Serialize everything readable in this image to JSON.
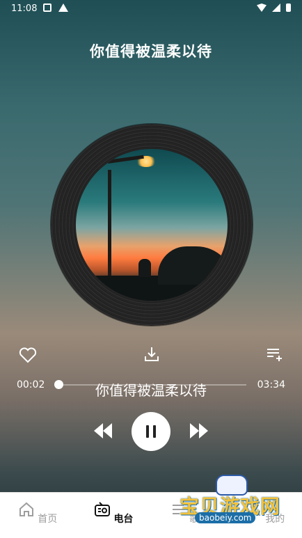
{
  "status_bar": {
    "time": "11:08"
  },
  "header": {
    "song_title": "你值得被温柔以待"
  },
  "player": {
    "current_time": "00:02",
    "total_time": "03:34",
    "progress": 0.01,
    "lyric": "你值得被温柔以待"
  },
  "nav": {
    "items": [
      {
        "label": "首页",
        "icon": "home-icon",
        "active": false
      },
      {
        "label": "电台",
        "icon": "radio-icon",
        "active": true
      },
      {
        "label": "歌单",
        "icon": "playlist-icon",
        "active": false
      },
      {
        "label": "我的",
        "icon": "profile-icon",
        "active": false
      }
    ]
  },
  "watermark": {
    "text": "宝贝游戏网",
    "url": "baobeiy.com"
  }
}
